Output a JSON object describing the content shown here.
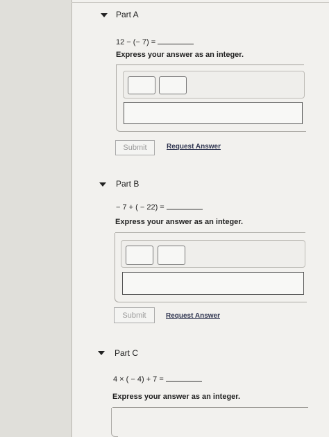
{
  "parts": [
    {
      "title": "Part A",
      "question": "12 − (− 7) =",
      "instruction": "Express your answer as an integer.",
      "answer_value": "",
      "submit_label": "Submit",
      "request_label": "Request Answer"
    },
    {
      "title": "Part B",
      "question": "− 7 + ( − 22) =",
      "instruction": "Express your answer as an integer.",
      "answer_value": "",
      "submit_label": "Submit",
      "request_label": "Request Answer"
    },
    {
      "title": "Part C",
      "question": "4 × ( − 4) + 7 =",
      "instruction": "Express your answer as an integer."
    }
  ]
}
